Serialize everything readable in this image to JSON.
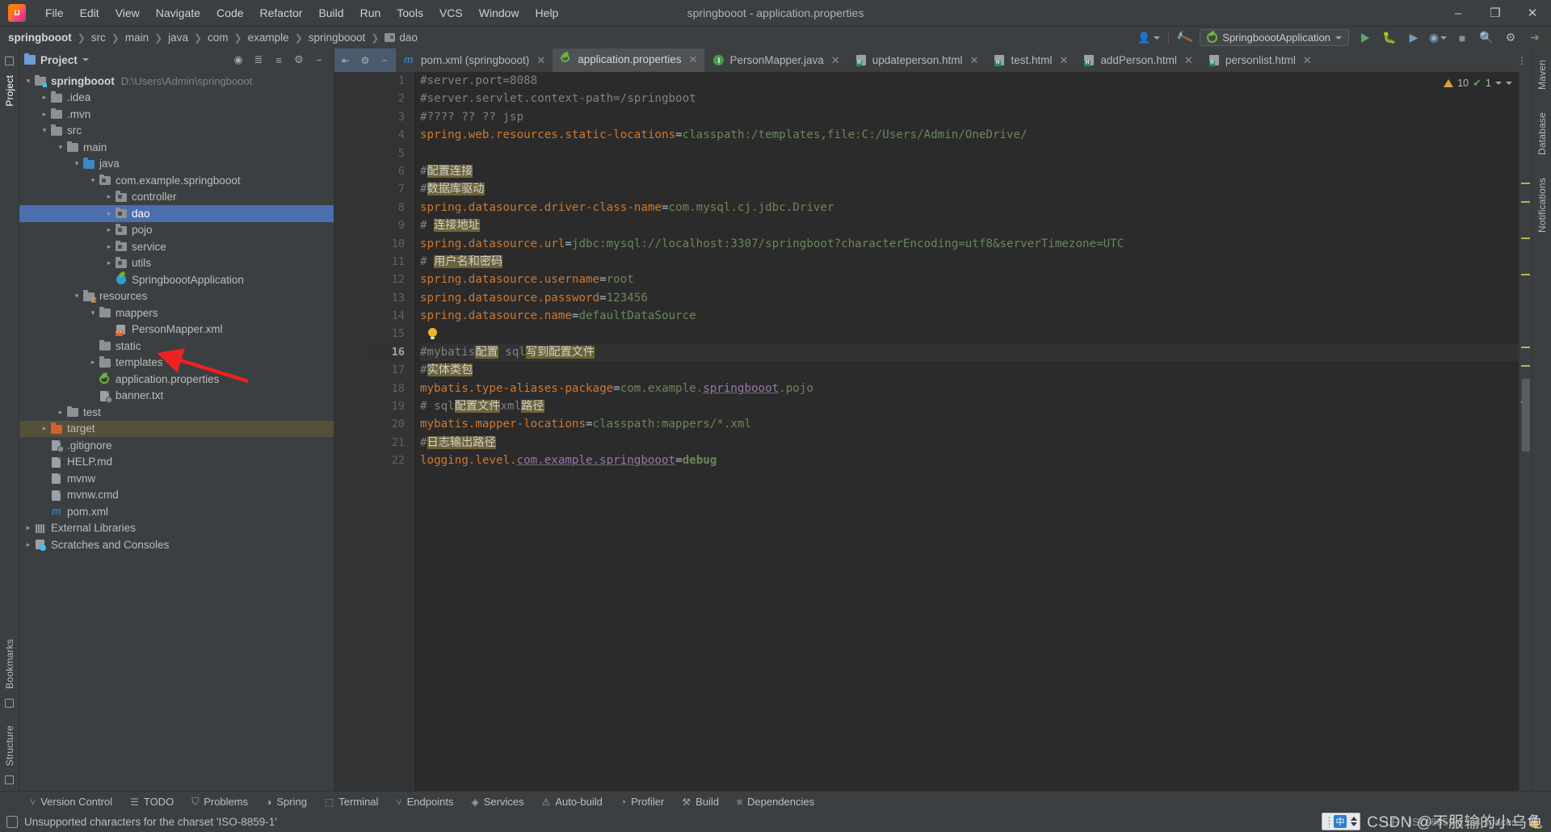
{
  "window": {
    "title": "springbooot - application.properties",
    "minimize": "–",
    "maximize": "❐",
    "close": "✕"
  },
  "menu": {
    "items": [
      "File",
      "Edit",
      "View",
      "Navigate",
      "Code",
      "Refactor",
      "Build",
      "Run",
      "Tools",
      "VCS",
      "Window",
      "Help"
    ]
  },
  "breadcrumb": {
    "items": [
      "springbooot",
      "src",
      "main",
      "java",
      "com",
      "example",
      "springbooot",
      "dao"
    ],
    "run_config": "SpringboootApplication"
  },
  "project_panel": {
    "title": "Project",
    "tree": [
      {
        "indent": 0,
        "chev": "open",
        "icon": "module-folder",
        "label": "springbooot",
        "bold": true,
        "path": "D:\\Users\\Admin\\springbooot"
      },
      {
        "indent": 1,
        "chev": "closed",
        "icon": "folder",
        "label": ".idea"
      },
      {
        "indent": 1,
        "chev": "closed",
        "icon": "folder",
        "label": ".mvn"
      },
      {
        "indent": 1,
        "chev": "open",
        "icon": "folder",
        "label": "src"
      },
      {
        "indent": 2,
        "chev": "open",
        "icon": "folder",
        "label": "main"
      },
      {
        "indent": 3,
        "chev": "open",
        "icon": "source-folder",
        "label": "java"
      },
      {
        "indent": 4,
        "chev": "open",
        "icon": "package-folder",
        "label": "com.example.springbooot"
      },
      {
        "indent": 5,
        "chev": "closed",
        "icon": "package-folder",
        "label": "controller"
      },
      {
        "indent": 5,
        "chev": "closed",
        "icon": "package-folder",
        "label": "dao",
        "selected": true
      },
      {
        "indent": 5,
        "chev": "closed",
        "icon": "package-folder",
        "label": "pojo"
      },
      {
        "indent": 5,
        "chev": "closed",
        "icon": "package-folder",
        "label": "service"
      },
      {
        "indent": 5,
        "chev": "closed",
        "icon": "package-folder",
        "label": "utils"
      },
      {
        "indent": 5,
        "chev": "none",
        "icon": "spring-class",
        "label": "SpringboootApplication"
      },
      {
        "indent": 3,
        "chev": "open",
        "icon": "resource-folder",
        "label": "resources"
      },
      {
        "indent": 4,
        "chev": "open",
        "icon": "folder",
        "label": "mappers"
      },
      {
        "indent": 5,
        "chev": "none",
        "icon": "xml-file",
        "label": "PersonMapper.xml"
      },
      {
        "indent": 4,
        "chev": "none",
        "icon": "folder",
        "label": "static"
      },
      {
        "indent": 4,
        "chev": "closed",
        "icon": "folder",
        "label": "templates"
      },
      {
        "indent": 4,
        "chev": "none",
        "icon": "spring-properties",
        "label": "application.properties"
      },
      {
        "indent": 4,
        "chev": "none",
        "icon": "text-file",
        "label": "banner.txt"
      },
      {
        "indent": 2,
        "chev": "closed",
        "icon": "folder",
        "label": "test"
      },
      {
        "indent": 1,
        "chev": "closed",
        "icon": "orange-folder",
        "label": "target",
        "highlight": true
      },
      {
        "indent": 1,
        "chev": "none",
        "icon": "git-file",
        "label": ".gitignore"
      },
      {
        "indent": 1,
        "chev": "none",
        "icon": "md-file",
        "label": "HELP.md"
      },
      {
        "indent": 1,
        "chev": "none",
        "icon": "script-file",
        "label": "mvnw"
      },
      {
        "indent": 1,
        "chev": "none",
        "icon": "script-file",
        "label": "mvnw.cmd"
      },
      {
        "indent": 1,
        "chev": "none",
        "icon": "maven-file",
        "label": "pom.xml"
      },
      {
        "indent": 0,
        "chev": "closed",
        "icon": "library",
        "label": "External Libraries"
      },
      {
        "indent": 0,
        "chev": "closed",
        "icon": "scratches",
        "label": "Scratches and Consoles"
      }
    ]
  },
  "left_strip": {
    "items": [
      "Project",
      "Bookmarks",
      "Structure"
    ]
  },
  "right_strip": {
    "items": [
      "Maven",
      "Database",
      "Notifications"
    ]
  },
  "tabs": [
    {
      "label": "pom.xml (springbooot)",
      "icon": "maven-icon",
      "active": false
    },
    {
      "label": "application.properties",
      "icon": "spring-icon",
      "active": true
    },
    {
      "label": "PersonMapper.java",
      "icon": "interface-icon",
      "active": false
    },
    {
      "label": "updateperson.html",
      "icon": "html-icon",
      "active": false
    },
    {
      "label": "test.html",
      "icon": "html-icon",
      "active": false
    },
    {
      "label": "addPerson.html",
      "icon": "html-icon",
      "active": false
    },
    {
      "label": "personlist.html",
      "icon": "html-icon",
      "active": false
    }
  ],
  "inspection": {
    "warnings": "10",
    "weak": "1"
  },
  "code": {
    "lines": [
      {
        "n": 1,
        "segments": [
          {
            "t": "#server.port=8088",
            "c": "cm"
          }
        ]
      },
      {
        "n": 2,
        "segments": [
          {
            "t": "#server.servlet.context-path=/springboot",
            "c": "cm"
          }
        ]
      },
      {
        "n": 3,
        "segments": [
          {
            "t": "#???? ?? ?? jsp",
            "c": "cm"
          }
        ]
      },
      {
        "n": 4,
        "segments": [
          {
            "t": "spring.web.resources.static-locations",
            "c": "key"
          },
          {
            "t": "=",
            "c": "sep"
          },
          {
            "t": "classpath:/templates,file:C:/Users/Admin/OneDrive/",
            "c": "val"
          }
        ]
      },
      {
        "n": 5,
        "segments": []
      },
      {
        "n": 6,
        "segments": [
          {
            "t": "#",
            "c": "cm"
          },
          {
            "t": "配置连接",
            "c": "cjk"
          }
        ]
      },
      {
        "n": 7,
        "segments": [
          {
            "t": "#",
            "c": "cm"
          },
          {
            "t": "数据库驱动",
            "c": "cjk"
          }
        ]
      },
      {
        "n": 8,
        "segments": [
          {
            "t": "spring.datasource.driver-class-name",
            "c": "key"
          },
          {
            "t": "=",
            "c": "sep"
          },
          {
            "t": "com.mysql.cj.jdbc.Driver",
            "c": "val"
          }
        ]
      },
      {
        "n": 9,
        "segments": [
          {
            "t": "# ",
            "c": "cm"
          },
          {
            "t": "连接地址",
            "c": "cjk"
          }
        ]
      },
      {
        "n": 10,
        "segments": [
          {
            "t": "spring.datasource.url",
            "c": "key"
          },
          {
            "t": "=",
            "c": "sep"
          },
          {
            "t": "jdbc:mysql://localhost:3307/springboot?characterEncoding=utf8&serverTimezone=UTC",
            "c": "val"
          }
        ]
      },
      {
        "n": 11,
        "segments": [
          {
            "t": "# ",
            "c": "cm"
          },
          {
            "t": "用户名和密码",
            "c": "cjk"
          }
        ]
      },
      {
        "n": 12,
        "segments": [
          {
            "t": "spring.datasource.username",
            "c": "key"
          },
          {
            "t": "=",
            "c": "sep"
          },
          {
            "t": "root",
            "c": "val"
          }
        ]
      },
      {
        "n": 13,
        "segments": [
          {
            "t": "spring.datasource.password",
            "c": "key"
          },
          {
            "t": "=",
            "c": "sep"
          },
          {
            "t": "123456",
            "c": "val"
          }
        ]
      },
      {
        "n": 14,
        "segments": [
          {
            "t": "spring.datasource.name",
            "c": "key"
          },
          {
            "t": "=",
            "c": "sep"
          },
          {
            "t": "defaultDataSource",
            "c": "val"
          }
        ]
      },
      {
        "n": 15,
        "segments": [],
        "bulb": true
      },
      {
        "n": 16,
        "current": true,
        "segments": [
          {
            "t": "#mybatis",
            "c": "cm"
          },
          {
            "t": "配置",
            "c": "cjk"
          },
          {
            "t": " sql",
            "c": "cm"
          },
          {
            "t": "写到配置文件",
            "c": "cjk"
          }
        ]
      },
      {
        "n": 17,
        "segments": [
          {
            "t": "#",
            "c": "cm"
          },
          {
            "t": "实体类包",
            "c": "cjk"
          }
        ]
      },
      {
        "n": 18,
        "segments": [
          {
            "t": "mybatis.type-aliases-package",
            "c": "key"
          },
          {
            "t": "=",
            "c": "sep"
          },
          {
            "t": "com.example.",
            "c": "val"
          },
          {
            "t": "springbooot",
            "c": "ident"
          },
          {
            "t": ".pojo",
            "c": "val"
          }
        ]
      },
      {
        "n": 19,
        "segments": [
          {
            "t": "# sql",
            "c": "cm"
          },
          {
            "t": "配置文件",
            "c": "cjk"
          },
          {
            "t": "xml",
            "c": "cm"
          },
          {
            "t": "路径",
            "c": "cjk"
          }
        ]
      },
      {
        "n": 20,
        "segments": [
          {
            "t": "mybatis.mapper-locations",
            "c": "key"
          },
          {
            "t": "=",
            "c": "sep"
          },
          {
            "t": "classpath:mappers/*.xml",
            "c": "val"
          }
        ]
      },
      {
        "n": 21,
        "segments": [
          {
            "t": "#",
            "c": "cm"
          },
          {
            "t": "日志输出路径",
            "c": "cjk"
          }
        ]
      },
      {
        "n": 22,
        "segments": [
          {
            "t": "logging.level.",
            "c": "key"
          },
          {
            "t": "com.example.springbooot",
            "c": "ident"
          },
          {
            "t": "=",
            "c": "sep"
          },
          {
            "t": "debug",
            "c": "valb"
          }
        ]
      }
    ]
  },
  "bottom_bar": {
    "items": [
      {
        "label": "Version Control",
        "icon": "branch-icon"
      },
      {
        "label": "TODO",
        "icon": "list-icon"
      },
      {
        "label": "Problems",
        "icon": "shield-icon"
      },
      {
        "label": "Spring",
        "icon": "spring-icon"
      },
      {
        "label": "Terminal",
        "icon": "terminal-icon"
      },
      {
        "label": "Endpoints",
        "icon": "endpoints-icon"
      },
      {
        "label": "Services",
        "icon": "services-icon"
      },
      {
        "label": "Auto-build",
        "icon": "build-warning-icon"
      },
      {
        "label": "Profiler",
        "icon": "profiler-icon"
      },
      {
        "label": "Build",
        "icon": "hammer-icon"
      },
      {
        "label": "Dependencies",
        "icon": "layers-icon"
      }
    ]
  },
  "status_bar": {
    "message": "Unsupported characters for the charset 'ISO-8859-1'",
    "line_sep": "LF",
    "encoding": "ISO-8859-1",
    "indent": "4 spaces"
  },
  "ime": {
    "label": "中"
  },
  "watermark": {
    "text": "CSDN @不服输的小乌龟"
  },
  "colors": {
    "bg_chrome": "#3c3f41",
    "bg_editor": "#2b2b2b",
    "selection_blue": "#4b6eaf",
    "highlight_olive": "#55503a",
    "comment_gray": "#808080",
    "key_orange": "#cc7832",
    "value_green": "#6a8759",
    "cjk_highlight": "#6d6339",
    "accent_arrow": "#ee2222"
  }
}
